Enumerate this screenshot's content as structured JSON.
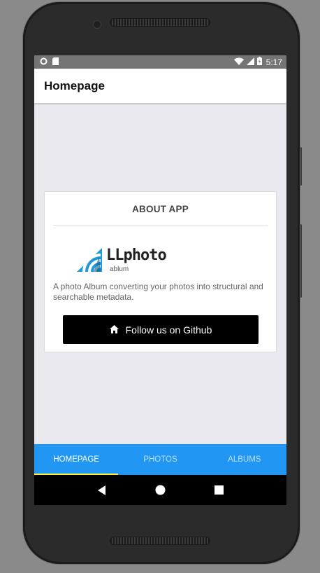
{
  "status_bar": {
    "time": "5:17"
  },
  "app_bar": {
    "title": "Homepage"
  },
  "about_card": {
    "title": "ABOUT APP",
    "logo_text": "LLphoto",
    "logo_subtext": "ablum",
    "description": "A photo Album converting your photos into structural and searchable metadata.",
    "github_button_label": "Follow us on Github"
  },
  "tabs": [
    {
      "label": "HOMEPAGE",
      "active": true
    },
    {
      "label": "PHOTOS",
      "active": false
    },
    {
      "label": "ALBUMS",
      "active": false
    }
  ],
  "colors": {
    "tab_bar": "#2196f3",
    "tab_indicator": "#ffeb3b",
    "status_bar": "#757575",
    "screen_bg": "#e9e9ef"
  },
  "icons": {
    "status_left": [
      "circle-icon",
      "sd-card-icon"
    ],
    "status_right": [
      "wifi-icon",
      "signal-icon",
      "battery-icon"
    ],
    "github_button": "home-icon",
    "nav": [
      "back-icon",
      "home-circle-icon",
      "recents-icon"
    ]
  }
}
